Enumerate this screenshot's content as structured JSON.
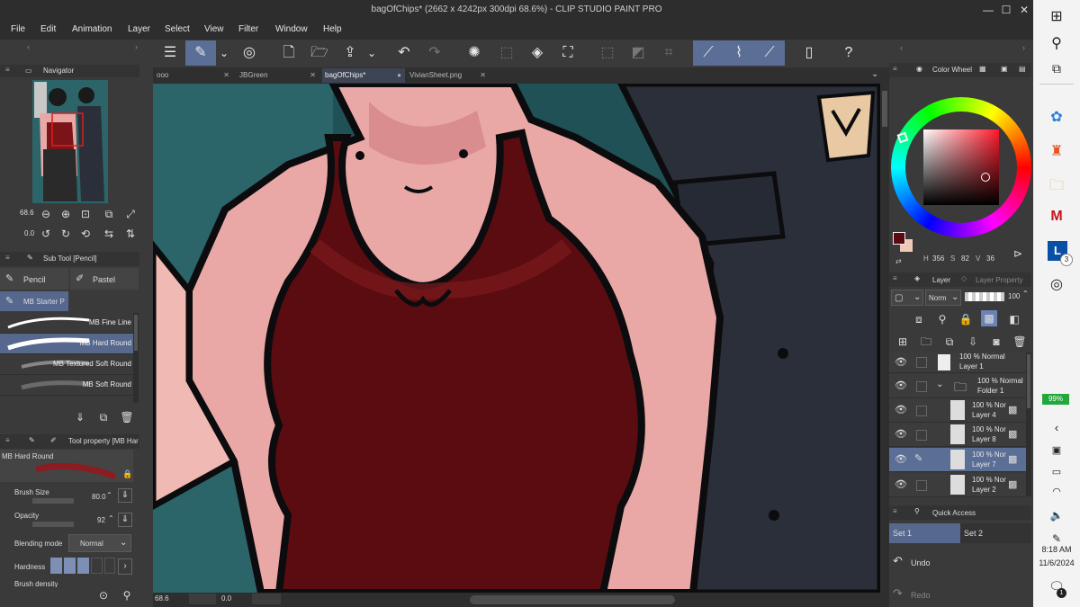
{
  "window": {
    "title": "bagOfChips* (2662 x 4242px 300dpi 68.6%) - CLIP STUDIO PAINT PRO",
    "minimize": "—",
    "maximize": "☐",
    "close": "✕"
  },
  "menu": [
    "File",
    "Edit",
    "Animation",
    "Layer",
    "Select",
    "View",
    "Filter",
    "Window",
    "Help"
  ],
  "tabs": [
    {
      "label": "ooo"
    },
    {
      "label": "JBGreen"
    },
    {
      "label": "bagOfChips*"
    },
    {
      "label": "VivianSheet.png"
    }
  ],
  "navigator": {
    "title": "Navigator",
    "zoom": "68.6",
    "rotation": "0.0"
  },
  "subtool": {
    "title": "Sub Tool [Pencil]",
    "groups": [
      "Pencil",
      "Pastel"
    ],
    "active_group": "MB Starter P",
    "brushes": [
      "MB Fine Line",
      "MB Hard Round",
      "MB Textured Soft Round",
      "MB Soft Round"
    ]
  },
  "tool_property": {
    "title": "Tool property [MB Har",
    "preset_name": "MB Hard Round",
    "brush_size_label": "Brush Size",
    "brush_size_value": "80.0",
    "opacity_label": "Opacity",
    "opacity_value": "92",
    "blend_label": "Blending mode",
    "blend_value": "Normal",
    "hardness_label": "Hardness",
    "density_label": "Brush density"
  },
  "status": {
    "zoom": "68.6",
    "rotation": "0.0"
  },
  "color_wheel": {
    "title": "Color Wheel",
    "h_label": "H",
    "h": "356",
    "s_label": "S",
    "s": "82",
    "v_label": "V",
    "v": "36",
    "main_color": "#5c0a0f",
    "sub_color": "#f0c8b8"
  },
  "layer_panel": {
    "tab_layer": "Layer",
    "tab_property": "Layer Property",
    "blend_mode": "Norm",
    "opacity": "100",
    "layers": [
      {
        "mode": "100 % Normal",
        "name": "Layer 1"
      },
      {
        "mode": "100 % Normal",
        "name": "Folder 1"
      },
      {
        "mode": "100 % Nor",
        "name": "Layer 4"
      },
      {
        "mode": "100 % Nor",
        "name": "Layer 8"
      },
      {
        "mode": "100 % Nor",
        "name": "Layer 7"
      },
      {
        "mode": "100 % Nor",
        "name": "Layer 2"
      }
    ]
  },
  "quick_access": {
    "title": "Quick Access",
    "sets": [
      "Set 1",
      "Set 2"
    ],
    "undo": "Undo",
    "redo": "Redo"
  },
  "taskbar": {
    "battery": "99%",
    "time": "8:18 AM",
    "date": "11/6/2024",
    "notif_badge": "1",
    "app_badge": "3"
  }
}
